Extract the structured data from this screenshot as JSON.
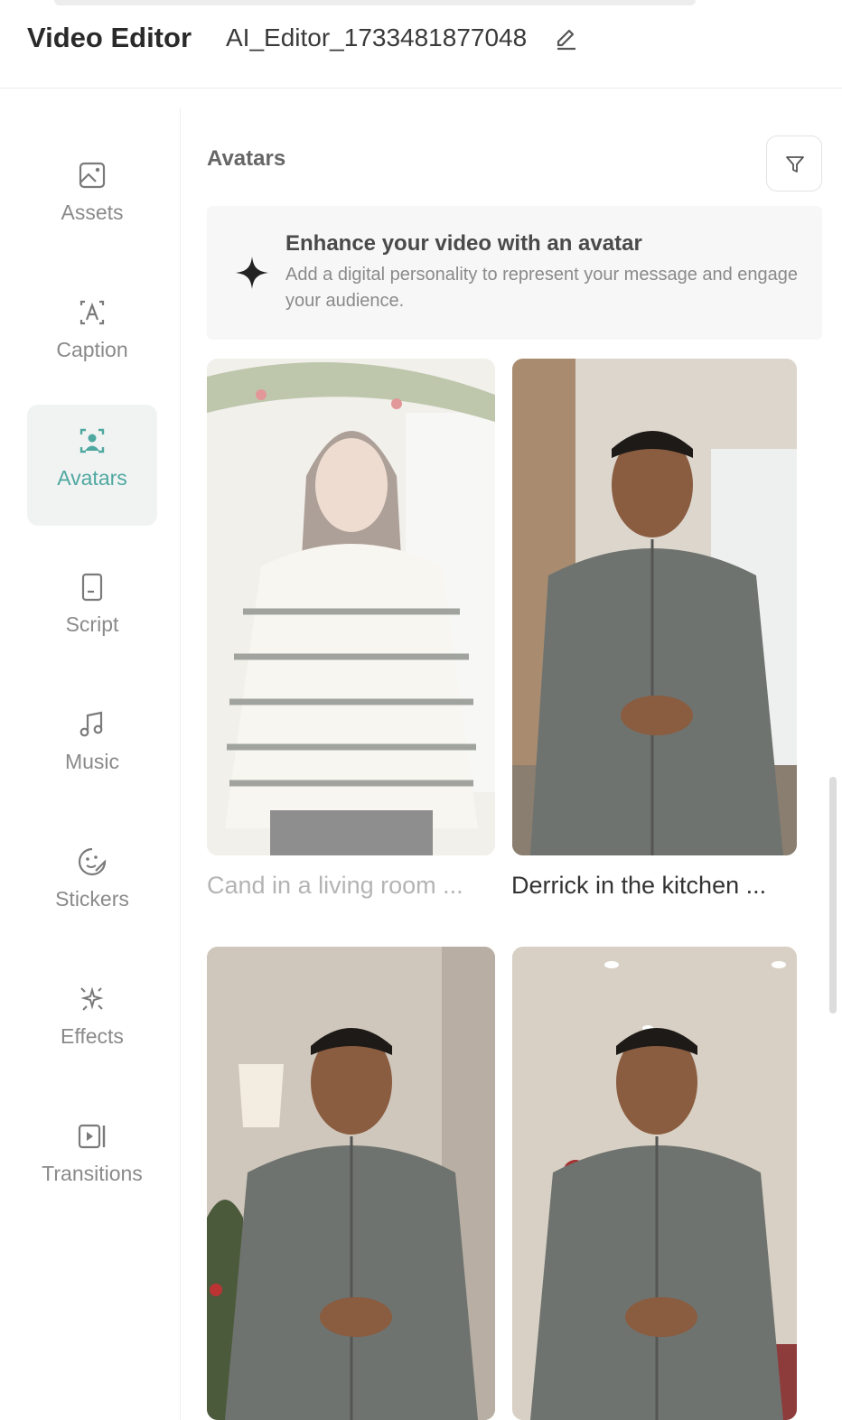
{
  "header": {
    "app_title": "Video Editor",
    "project_name": "AI_Editor_1733481877048"
  },
  "sidebar": {
    "items": [
      {
        "label": "Assets",
        "icon": "image-icon",
        "active": false
      },
      {
        "label": "Caption",
        "icon": "caption-icon",
        "active": false
      },
      {
        "label": "Avatars",
        "icon": "avatar-icon",
        "active": true
      },
      {
        "label": "Script",
        "icon": "script-icon",
        "active": false
      },
      {
        "label": "Music",
        "icon": "music-note-icon",
        "active": false
      },
      {
        "label": "Stickers",
        "icon": "sticker-icon",
        "active": false
      },
      {
        "label": "Effects",
        "icon": "sparkle-effects-icon",
        "active": false
      },
      {
        "label": "Transitions",
        "icon": "transition-icon",
        "active": false
      }
    ]
  },
  "main": {
    "section_title": "Avatars",
    "promo": {
      "title": "Enhance your video with an avatar",
      "description": "Add a digital personality to represent your message and engage your audience."
    },
    "avatars": [
      {
        "label": "Cand in a living room ...",
        "dimmed": true
      },
      {
        "label": "Derrick in the kitchen ...",
        "dimmed": false
      },
      {
        "label": "",
        "dimmed": false
      },
      {
        "label": "",
        "dimmed": false
      }
    ]
  },
  "colors": {
    "accent": "#4fa8a0",
    "muted_text": "#8a8a8a",
    "promo_bg": "#f7f7f7"
  }
}
